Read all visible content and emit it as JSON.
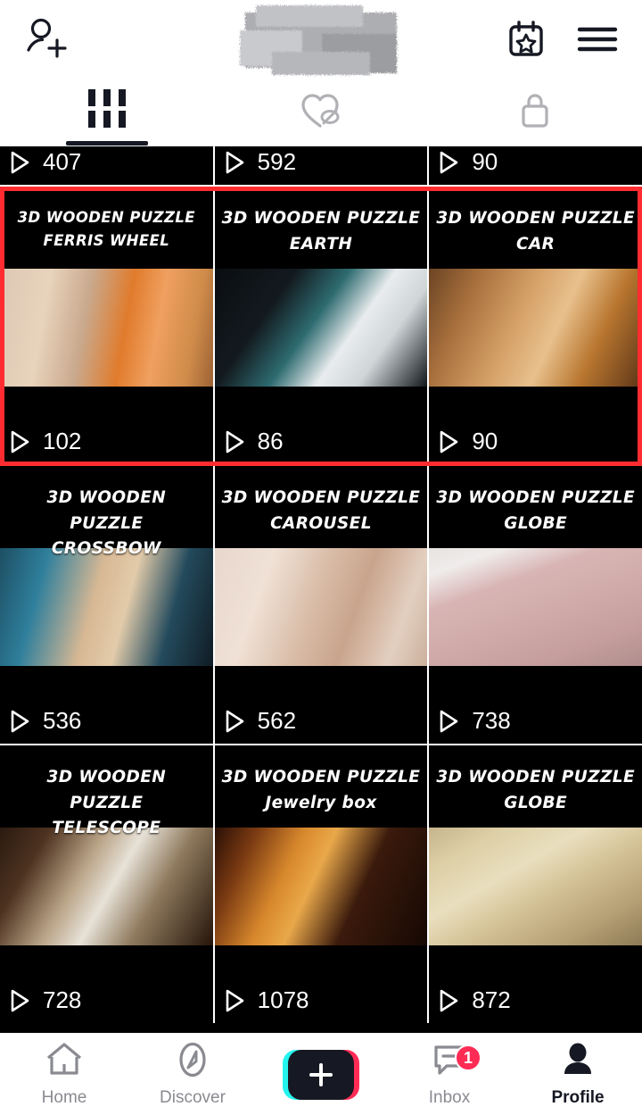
{
  "header": {
    "add_friend_icon": "add-person-icon",
    "title_redacted": "",
    "calendar_icon": "calendar-star-icon",
    "menu_icon": "hamburger-menu-icon"
  },
  "tabs": [
    {
      "icon": "grid-icon",
      "name": "posts",
      "active": true
    },
    {
      "icon": "heart-hidden-icon",
      "name": "liked",
      "active": false
    },
    {
      "icon": "lock-icon",
      "name": "private",
      "active": false
    }
  ],
  "highlight": {
    "color": "#fe2c30",
    "row_index": 1
  },
  "grid": {
    "partial_row": [
      {
        "views": "407"
      },
      {
        "views": "592"
      },
      {
        "views": "90"
      }
    ],
    "rows": [
      {
        "highlighted": true,
        "cells": [
          {
            "title_line1": "3D WOODEN PUZZLE",
            "title_line2": "FERRIS WHEEL",
            "views": "102",
            "thumb": "ferris-wheel"
          },
          {
            "title_line1": "3D WOODEN PUZZLE",
            "title_line2": "EARTH",
            "views": "86",
            "thumb": "earth"
          },
          {
            "title_line1": "3D WOODEN PUZZLE",
            "title_line2": "CAR",
            "views": "90",
            "thumb": "car"
          }
        ]
      },
      {
        "highlighted": false,
        "cells": [
          {
            "title_line1": "3D WOODEN PUZZLE",
            "title_line2": "CROSSBOW",
            "views": "536",
            "thumb": "crossbow"
          },
          {
            "title_line1": "3D WOODEN PUZZLE",
            "title_line2": "CAROUSEL",
            "views": "562",
            "thumb": "carousel"
          },
          {
            "title_line1": "3D WOODEN PUZZLE",
            "title_line2": "GLOBE",
            "views": "738",
            "thumb": "globe-desk"
          }
        ]
      },
      {
        "highlighted": false,
        "cells": [
          {
            "title_line1": "3D WOODEN PUZZLE",
            "title_line2": "TELESCOPE",
            "views": "728",
            "thumb": "telescope"
          },
          {
            "title_line1": "3D WOODEN PUZZLE",
            "title_line2": "Jewelry box",
            "views": "1078",
            "thumb": "jewelry-box"
          },
          {
            "title_line1": "3D  WOODEN PUZZLE",
            "title_line2": "GLOBE",
            "views": "872",
            "thumb": "globe-table"
          }
        ]
      }
    ]
  },
  "bottom_nav": {
    "items": [
      {
        "label": "Home",
        "icon": "home-icon",
        "active": false
      },
      {
        "label": "Discover",
        "icon": "compass-icon",
        "active": false
      },
      {
        "label": "",
        "icon": "create-icon",
        "active": false
      },
      {
        "label": "Inbox",
        "icon": "message-icon",
        "active": false,
        "badge": "1"
      },
      {
        "label": "Profile",
        "icon": "person-icon",
        "active": true
      }
    ]
  },
  "colors": {
    "accent_pink": "#fe2c55",
    "accent_cyan": "#25f4ee",
    "highlight_red": "#fe2c30",
    "text_dark": "#161823",
    "text_gray": "#8a8b91"
  }
}
